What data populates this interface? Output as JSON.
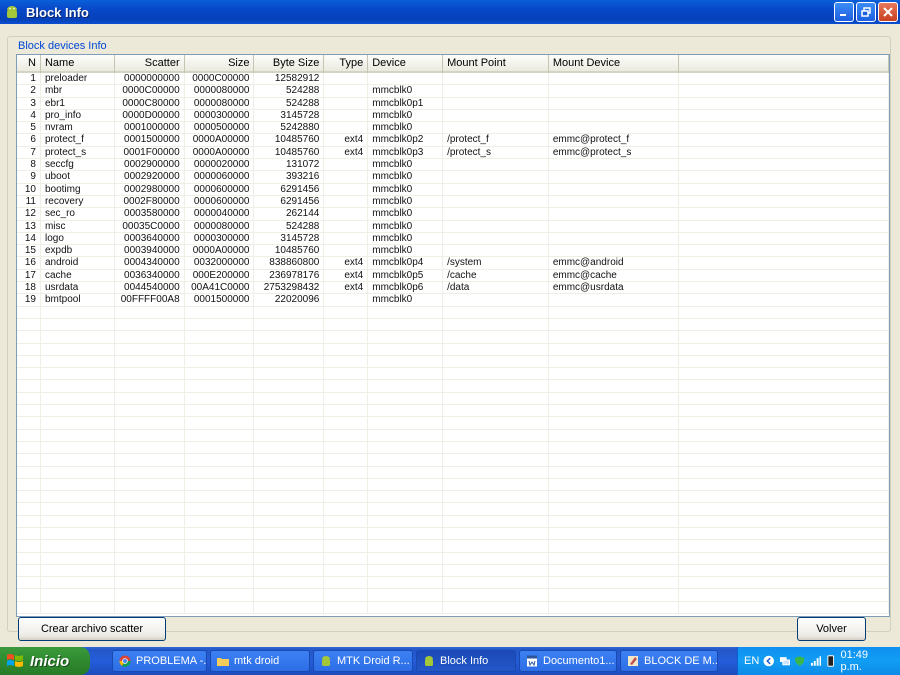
{
  "window": {
    "title": "Block Info"
  },
  "groupbox": {
    "legend": "Block devices Info"
  },
  "table": {
    "headers": [
      "N",
      "Name",
      "Scatter",
      "Size",
      "Byte Size",
      "Type",
      "Device",
      "Mount Point",
      "Mount Device"
    ],
    "rows": [
      [
        "1",
        "preloader",
        "0000000000",
        "0000C00000",
        "12582912",
        "",
        "",
        "",
        ""
      ],
      [
        "2",
        "mbr",
        "0000C00000",
        "0000080000",
        "524288",
        "",
        "mmcblk0",
        "",
        ""
      ],
      [
        "3",
        "ebr1",
        "0000C80000",
        "0000080000",
        "524288",
        "",
        "mmcblk0p1",
        "",
        ""
      ],
      [
        "4",
        "pro_info",
        "0000D00000",
        "0000300000",
        "3145728",
        "",
        "mmcblk0",
        "",
        ""
      ],
      [
        "5",
        "nvram",
        "0001000000",
        "0000500000",
        "5242880",
        "",
        "mmcblk0",
        "",
        ""
      ],
      [
        "6",
        "protect_f",
        "0001500000",
        "0000A00000",
        "10485760",
        "ext4",
        "mmcblk0p2",
        "/protect_f",
        "emmc@protect_f"
      ],
      [
        "7",
        "protect_s",
        "0001F00000",
        "0000A00000",
        "10485760",
        "ext4",
        "mmcblk0p3",
        "/protect_s",
        "emmc@protect_s"
      ],
      [
        "8",
        "seccfg",
        "0002900000",
        "0000020000",
        "131072",
        "",
        "mmcblk0",
        "",
        ""
      ],
      [
        "9",
        "uboot",
        "0002920000",
        "0000060000",
        "393216",
        "",
        "mmcblk0",
        "",
        ""
      ],
      [
        "10",
        "bootimg",
        "0002980000",
        "0000600000",
        "6291456",
        "",
        "mmcblk0",
        "",
        ""
      ],
      [
        "11",
        "recovery",
        "0002F80000",
        "0000600000",
        "6291456",
        "",
        "mmcblk0",
        "",
        ""
      ],
      [
        "12",
        "sec_ro",
        "0003580000",
        "0000040000",
        "262144",
        "",
        "mmcblk0",
        "",
        ""
      ],
      [
        "13",
        "misc",
        "00035C0000",
        "0000080000",
        "524288",
        "",
        "mmcblk0",
        "",
        ""
      ],
      [
        "14",
        "logo",
        "0003640000",
        "0000300000",
        "3145728",
        "",
        "mmcblk0",
        "",
        ""
      ],
      [
        "15",
        "expdb",
        "0003940000",
        "0000A00000",
        "10485760",
        "",
        "mmcblk0",
        "",
        ""
      ],
      [
        "16",
        "android",
        "0004340000",
        "0032000000",
        "838860800",
        "ext4",
        "mmcblk0p4",
        "/system",
        "emmc@android"
      ],
      [
        "17",
        "cache",
        "0036340000",
        "000E200000",
        "236978176",
        "ext4",
        "mmcblk0p5",
        "/cache",
        "emmc@cache"
      ],
      [
        "18",
        "usrdata",
        "0044540000",
        "00A41C0000",
        "2753298432",
        "ext4",
        "mmcblk0p6",
        "/data",
        "emmc@usrdata"
      ],
      [
        "19",
        "bmtpool",
        "00FFFF00A8",
        "0001500000",
        "22020096",
        "",
        "mmcblk0",
        "",
        ""
      ]
    ]
  },
  "buttons": {
    "scatter": "Crear archivo scatter",
    "volver": "Volver"
  },
  "taskbar": {
    "start": "Inicio",
    "items": [
      {
        "label": "PROBLEMA -...",
        "icon": "chrome-icon"
      },
      {
        "label": "mtk droid",
        "icon": "folder-icon"
      },
      {
        "label": "MTK Droid R...",
        "icon": "android-icon"
      },
      {
        "label": "Block Info",
        "icon": "android-icon"
      },
      {
        "label": "Documento1...",
        "icon": "word-icon"
      },
      {
        "label": "BLOCK DE M...",
        "icon": "paint-icon"
      }
    ],
    "language": "EN",
    "clock": "01:49 p.m."
  },
  "colors": {
    "titlebar": "#0747c9",
    "legend": "#0046d5",
    "taskbar": "#245dda",
    "start": "#2f8a2f"
  }
}
